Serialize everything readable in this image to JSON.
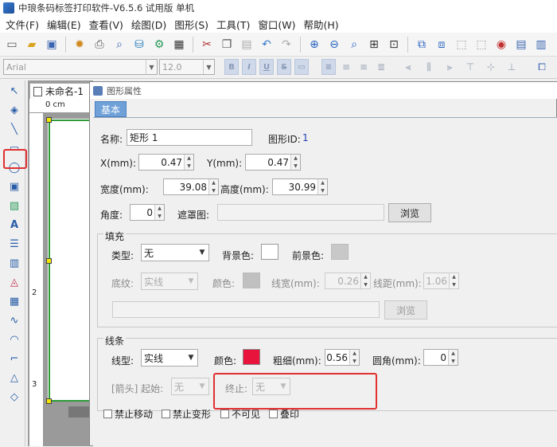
{
  "window": {
    "title": "中琅条码标签打印软件-V6.5.6 试用版 单机"
  },
  "menu": [
    "文件(F)",
    "编辑(E)",
    "查看(V)",
    "绘图(D)",
    "图形(S)",
    "工具(T)",
    "窗口(W)",
    "帮助(H)"
  ],
  "format_bar": {
    "font_name": "Arial",
    "font_size": "12.0",
    "bold": "B",
    "italic": "I",
    "underline": "U",
    "strike": "S"
  },
  "document": {
    "tab_label": "未命名-1",
    "ruler_h": "0 cm",
    "ruler_v_2": "2",
    "ruler_v_3": "3"
  },
  "dialog": {
    "title": "图形属性",
    "tab_label": "基本",
    "name_label": "名称:",
    "name_value": "矩形 1",
    "shape_id_label": "图形ID:",
    "shape_id_value": "1",
    "x_label": "X(mm):",
    "x_value": "0.47",
    "y_label": "Y(mm):",
    "y_value": "0.47",
    "width_label": "宽度(mm):",
    "width_value": "39.08",
    "height_label": "高度(mm):",
    "height_value": "30.99",
    "angle_label": "角度:",
    "angle_value": "0",
    "mask_label": "遮罩图:",
    "browse_label": "浏览",
    "fill": {
      "group_label": "填充",
      "type_label": "类型:",
      "type_value": "无",
      "bg_color_label": "背景色:",
      "fg_color_label": "前景色:",
      "pattern_label": "底纹:",
      "pattern_value": "实线",
      "color_label": "颜色:",
      "line_width_label": "线宽(mm):",
      "line_width_value": "0.26",
      "line_spacing_label": "线距(mm):",
      "line_spacing_value": "1.06",
      "browse_label": "浏览"
    },
    "line": {
      "group_label": "线条",
      "style_label": "线型:",
      "style_value": "实线",
      "color_label": "颜色:",
      "color_hex": "#e8143c",
      "thickness_label": "粗细(mm):",
      "thickness_value": "0.56",
      "corner_label": "圆角(mm):",
      "corner_value": "0",
      "arrow_label": "[箭头] 起始:",
      "arrow_start_value": "无",
      "arrow_end_label": "终止:",
      "arrow_end_value": "无"
    },
    "checkboxes": [
      "禁止移动",
      "禁止变形",
      "不可见",
      "叠印"
    ]
  },
  "colors": {
    "highlight": "#e03030",
    "shape_border": "#2e9a3a",
    "handle": "#f5e600",
    "tab": "#6fa0d8"
  }
}
